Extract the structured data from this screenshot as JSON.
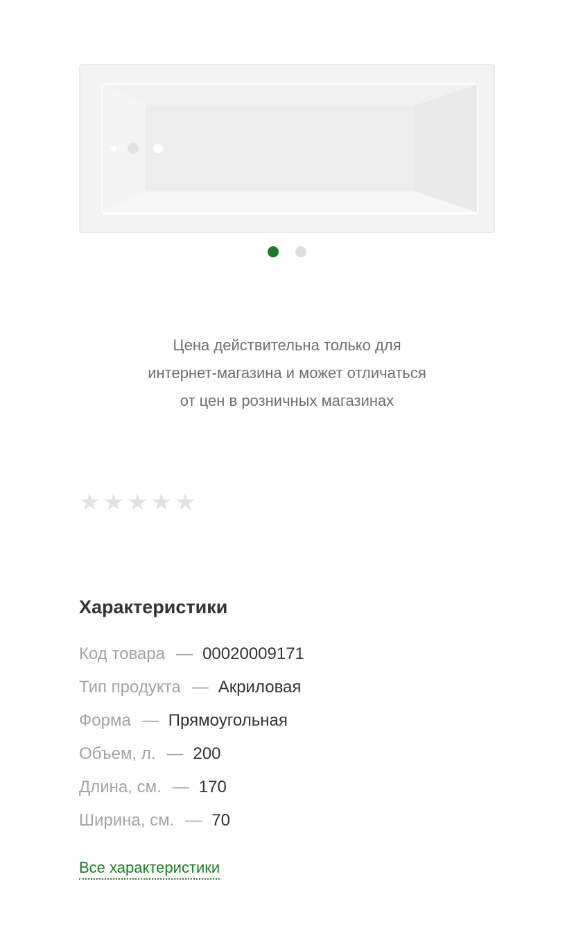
{
  "gallery": {
    "image_alt": "Акриловая ванна",
    "slides_total": 2,
    "active_slide": 1
  },
  "price_note": {
    "lines": [
      "Цена действительна только для",
      "интернет-магазина и может отличаться",
      "от цен в розничных магазинах"
    ]
  },
  "rating": {
    "value": 0,
    "max": 5,
    "star_glyph": "★",
    "empty_color": "#e3e3e3"
  },
  "specs": {
    "title": "Характеристики",
    "separator": "—",
    "rows": [
      {
        "label": "Код товара",
        "value": "00020009171"
      },
      {
        "label": "Тип продукта",
        "value": "Акриловая"
      },
      {
        "label": "Форма",
        "value": "Прямоугольная"
      },
      {
        "label": "Объем, л.",
        "value": "200"
      },
      {
        "label": "Длина, см.",
        "value": "170"
      },
      {
        "label": "Ширина, см.",
        "value": "70"
      }
    ],
    "all_link": "Все характеристики"
  },
  "colors": {
    "accent": "#1b7d23",
    "inactive_dot": "#dcdcdc",
    "muted_text": "#a3a3a3",
    "body_text": "#333333"
  }
}
